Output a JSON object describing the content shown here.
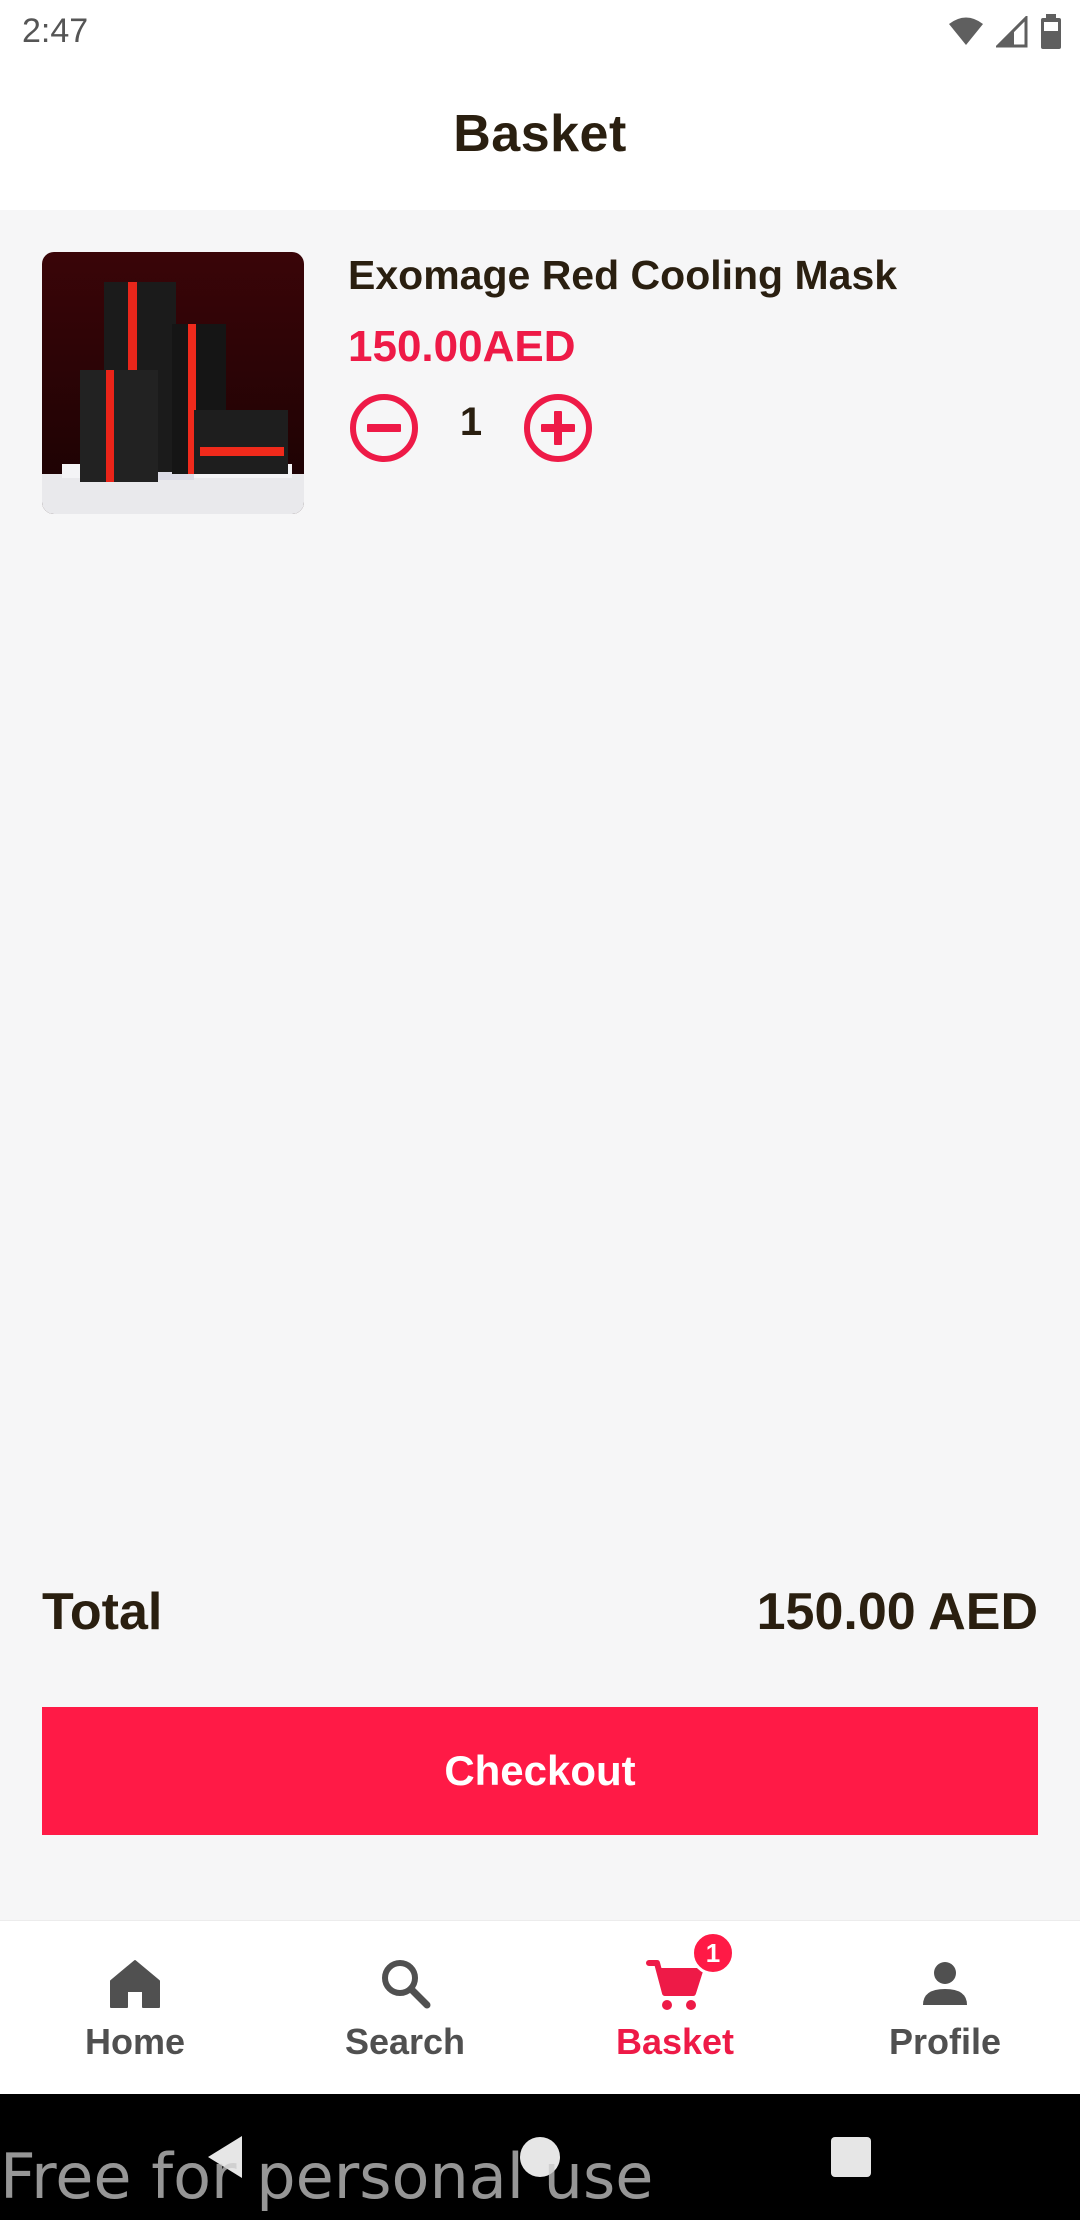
{
  "status_bar": {
    "time": "2:47",
    "icons": [
      "wifi-icon",
      "cell-signal-icon",
      "battery-icon"
    ]
  },
  "header": {
    "title": "Basket"
  },
  "cart": {
    "items": [
      {
        "name": "Exomage Red Cooling Mask",
        "price": "150.00AED",
        "quantity": "1",
        "image": "product-boxes-image"
      }
    ]
  },
  "summary": {
    "total_label": "Total",
    "total_value": "150.00 AED",
    "checkout_label": "Checkout"
  },
  "bottom_nav": {
    "items": [
      {
        "label": "Home",
        "icon": "home-icon"
      },
      {
        "label": "Search",
        "icon": "search-icon"
      },
      {
        "label": "Basket",
        "icon": "cart-icon",
        "badge": "1",
        "active": true
      },
      {
        "label": "Profile",
        "icon": "person-icon"
      }
    ]
  },
  "system_nav": {
    "buttons": [
      "back-icon",
      "home-circle-icon",
      "recents-icon"
    ]
  },
  "watermark": "Free for personal use",
  "colors": {
    "accent": "#ff1a46",
    "price": "#ee1a47",
    "text": "#2a1f10",
    "background": "#f6f6f7"
  }
}
